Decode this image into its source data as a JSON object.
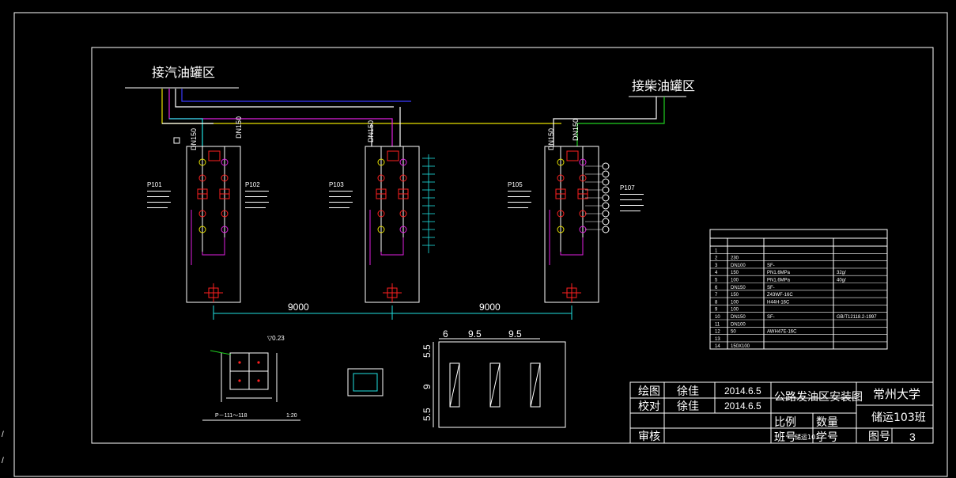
{
  "title_gas": "接汽油罐区",
  "title_diesel": "接柴油罐区",
  "dn_label": "DN150",
  "pumps": [
    "P101",
    "P102",
    "P103",
    "P105",
    "P107"
  ],
  "dimension_9000": "9000",
  "foundation_dims": [
    "6",
    "9.5",
    "9.5",
    "5.5",
    "9",
    "5.5"
  ],
  "detail_caption": "P－111～118",
  "detail_scale": "1:20",
  "detail_level": "▽0.23",
  "title_block": {
    "drawn_label": "绘图",
    "drawn_by": "徐佳",
    "drawn_date": "2014.6.5",
    "checked_label": "校对",
    "checked_by": "徐佳",
    "checked_date": "2014.6.5",
    "review_label": "审核",
    "drawing_title": "公路发油区安装图",
    "school": "常州大学",
    "class": "储运103班",
    "scale_label": "比例",
    "qty_label": "数量",
    "class_no_label": "班号",
    "class_no": "储运103",
    "student_no_label": "学号",
    "drawing_no_label": "图号",
    "drawing_no": "3"
  },
  "legend": {
    "rows": [
      [
        "1",
        "",
        "",
        ""
      ],
      [
        "2",
        "230",
        "",
        ""
      ],
      [
        "3",
        "DN100",
        "SF-",
        ""
      ],
      [
        "4",
        "150",
        "PN1.6MPa",
        "32g/"
      ],
      [
        "5",
        "100",
        "PN1.6MPa",
        "40g/"
      ],
      [
        "6",
        "DN150",
        "SF-",
        ""
      ],
      [
        "7",
        "150",
        "Z43WF-16C",
        ""
      ],
      [
        "8",
        "100",
        "H44H-16C",
        ""
      ],
      [
        "9",
        "100",
        "",
        ""
      ],
      [
        "10",
        "DN150",
        "SF-",
        "GB/T12118.2-1997"
      ],
      [
        "11",
        "DN100",
        "",
        ""
      ],
      [
        "12",
        "50",
        "AWH47E-16C",
        ""
      ],
      [
        "13",
        "",
        "",
        ""
      ],
      [
        "14",
        "150X100",
        "",
        ""
      ]
    ]
  },
  "colors": {
    "line": "#ffffff",
    "pipe_yellow": "#e6e000",
    "pipe_blue": "#3a3aff",
    "pipe_magenta": "#e020e0",
    "pipe_green": "#20d020",
    "pipe_cyan": "#20e0e0",
    "mark_red": "#ff2020"
  }
}
